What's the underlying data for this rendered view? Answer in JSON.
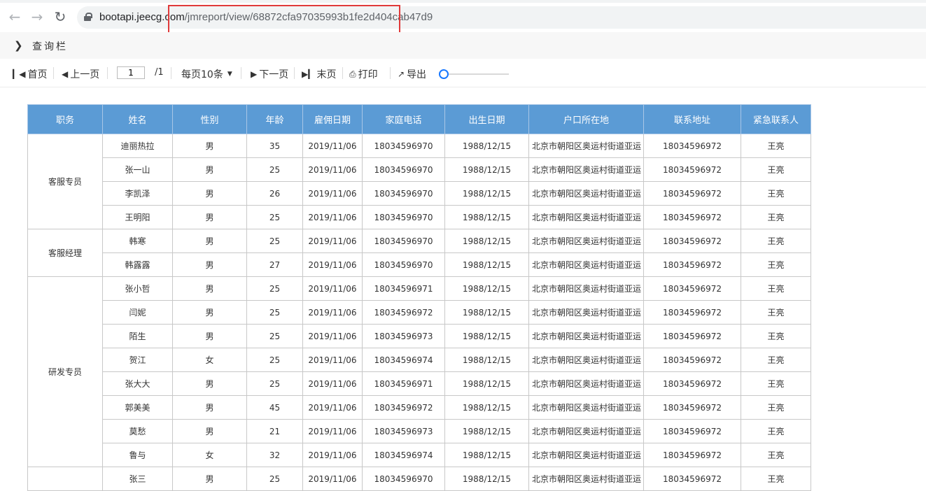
{
  "browser": {
    "url_host": "bootapi.jeecg.com",
    "url_path": "/jmreport/view/68872cfa97035993b1fe2d404cab47d9"
  },
  "query_bar": {
    "label": "查询栏"
  },
  "toolbar": {
    "first": "首页",
    "prev": "上一页",
    "page_value": "1",
    "page_total": "/1",
    "page_size": "每页10条",
    "next": "下一页",
    "last": "末页",
    "print": "打印",
    "export": "导出",
    "zoom_level": 0
  },
  "table": {
    "headers": [
      "职务",
      "姓名",
      "性别",
      "年龄",
      "雇佣日期",
      "家庭电话",
      "出生日期",
      "户口所在地",
      "联系地址",
      "紧急联系人"
    ],
    "groups": [
      {
        "title": "客服专员",
        "rows": [
          [
            "迪丽热拉",
            "男",
            "35",
            "2019/11/06",
            "18034596970",
            "1988/12/15",
            "北京市朝阳区奥运村街道亚运",
            "18034596972",
            "王亮"
          ],
          [
            "张一山",
            "男",
            "25",
            "2019/11/06",
            "18034596970",
            "1988/12/15",
            "北京市朝阳区奥运村街道亚运",
            "18034596972",
            "王亮"
          ],
          [
            "李凯泽",
            "男",
            "26",
            "2019/11/06",
            "18034596970",
            "1988/12/15",
            "北京市朝阳区奥运村街道亚运",
            "18034596972",
            "王亮"
          ],
          [
            "王明阳",
            "男",
            "25",
            "2019/11/06",
            "18034596970",
            "1988/12/15",
            "北京市朝阳区奥运村街道亚运",
            "18034596972",
            "王亮"
          ]
        ]
      },
      {
        "title": "客服经理",
        "rows": [
          [
            "韩寒",
            "男",
            "25",
            "2019/11/06",
            "18034596970",
            "1988/12/15",
            "北京市朝阳区奥运村街道亚运",
            "18034596972",
            "王亮"
          ],
          [
            "韩露露",
            "男",
            "27",
            "2019/11/06",
            "18034596970",
            "1988/12/15",
            "北京市朝阳区奥运村街道亚运",
            "18034596972",
            "王亮"
          ]
        ]
      },
      {
        "title": "研发专员",
        "rows": [
          [
            "张小哲",
            "男",
            "25",
            "2019/11/06",
            "18034596971",
            "1988/12/15",
            "北京市朝阳区奥运村街道亚运",
            "18034596972",
            "王亮"
          ],
          [
            "闫妮",
            "男",
            "25",
            "2019/11/06",
            "18034596972",
            "1988/12/15",
            "北京市朝阳区奥运村街道亚运",
            "18034596972",
            "王亮"
          ],
          [
            "陌生",
            "男",
            "25",
            "2019/11/06",
            "18034596973",
            "1988/12/15",
            "北京市朝阳区奥运村街道亚运",
            "18034596972",
            "王亮"
          ],
          [
            "贺江",
            "女",
            "25",
            "2019/11/06",
            "18034596974",
            "1988/12/15",
            "北京市朝阳区奥运村街道亚运",
            "18034596972",
            "王亮"
          ],
          [
            "张大大",
            "男",
            "25",
            "2019/11/06",
            "18034596971",
            "1988/12/15",
            "北京市朝阳区奥运村街道亚运",
            "18034596972",
            "王亮"
          ],
          [
            "郭美美",
            "男",
            "45",
            "2019/11/06",
            "18034596972",
            "1988/12/15",
            "北京市朝阳区奥运村街道亚运",
            "18034596972",
            "王亮"
          ],
          [
            "莫愁",
            "男",
            "21",
            "2019/11/06",
            "18034596973",
            "1988/12/15",
            "北京市朝阳区奥运村街道亚运",
            "18034596972",
            "王亮"
          ],
          [
            "鲁与",
            "女",
            "32",
            "2019/11/06",
            "18034596974",
            "1988/12/15",
            "北京市朝阳区奥运村街道亚运",
            "18034596972",
            "王亮"
          ]
        ]
      },
      {
        "title": "",
        "rows": [
          [
            "张三",
            "男",
            "25",
            "2019/11/06",
            "18034596970",
            "1988/12/15",
            "北京市朝阳区奥运村街道亚运",
            "18034596972",
            "王亮"
          ]
        ]
      }
    ]
  }
}
